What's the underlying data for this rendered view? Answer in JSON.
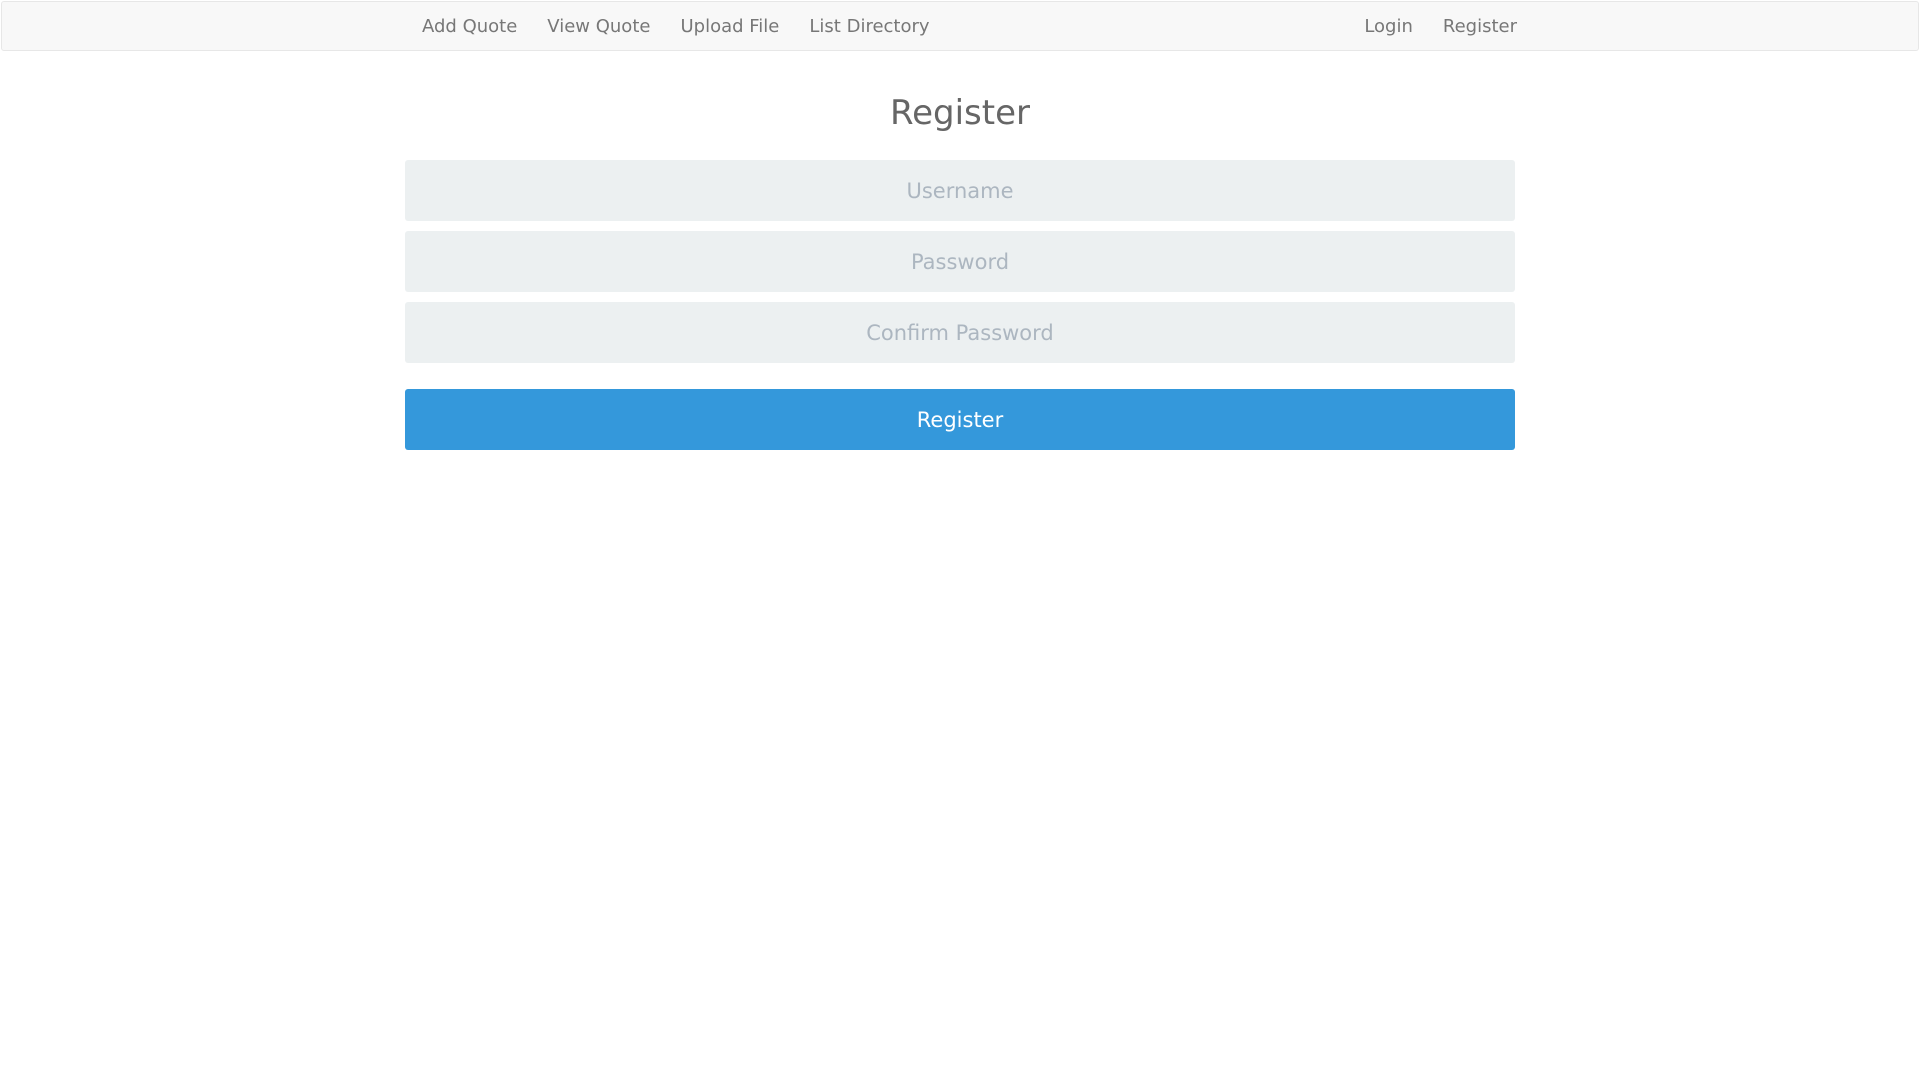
{
  "navbar": {
    "left_links": [
      {
        "label": "Add Quote"
      },
      {
        "label": "View Quote"
      },
      {
        "label": "Upload File"
      },
      {
        "label": "List Directory"
      }
    ],
    "right_links": [
      {
        "label": "Login"
      },
      {
        "label": "Register"
      }
    ]
  },
  "page": {
    "title": "Register"
  },
  "form": {
    "username": {
      "value": "",
      "placeholder": "Username"
    },
    "password": {
      "value": "",
      "placeholder": "Password"
    },
    "confirm_password": {
      "value": "",
      "placeholder": "Confirm Password"
    },
    "submit_label": "Register"
  },
  "colors": {
    "navbar_bg": "#f8f8f8",
    "field_bg": "#ecf0f1",
    "primary": "#3498db"
  }
}
